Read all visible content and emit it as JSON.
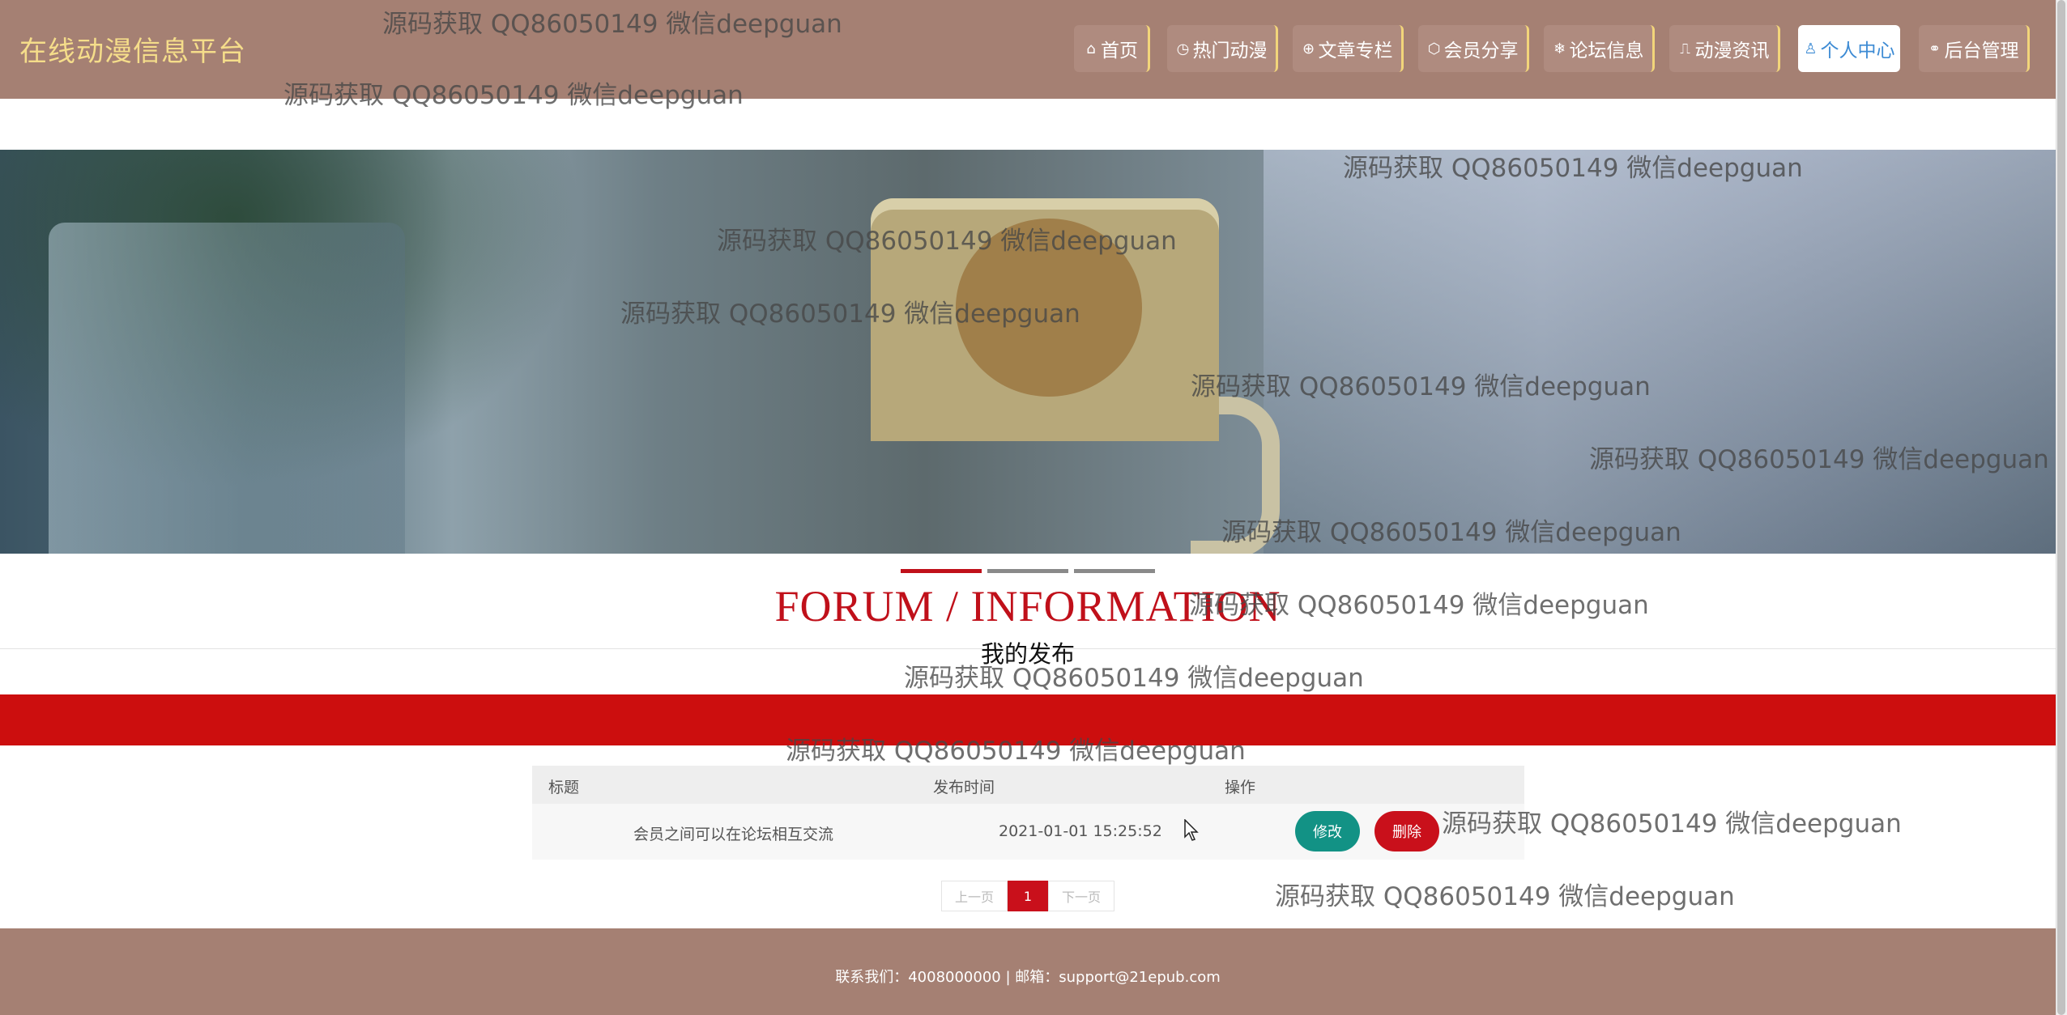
{
  "header": {
    "brand": "在线动漫信息平台",
    "nav": [
      {
        "label": "首页",
        "icon": "home-icon",
        "glyph": "⌂"
      },
      {
        "label": "热门动漫",
        "icon": "clock-icon",
        "glyph": "◷"
      },
      {
        "label": "文章专栏",
        "icon": "globe-icon",
        "glyph": "⊕"
      },
      {
        "label": "会员分享",
        "icon": "box-icon",
        "glyph": "⬡"
      },
      {
        "label": "论坛信息",
        "icon": "snowflake-icon",
        "glyph": "❄"
      },
      {
        "label": "动漫资讯",
        "icon": "book-icon",
        "glyph": "⎍"
      },
      {
        "label": "个人中心",
        "icon": "user-icon",
        "glyph": "♙"
      },
      {
        "label": "后台管理",
        "icon": "link-icon",
        "glyph": "⚭"
      }
    ],
    "active_nav": "个人中心"
  },
  "section": {
    "title_en": "FORUM / INFORMATION",
    "title_cn": "我的发布"
  },
  "table": {
    "headers": [
      "标题",
      "发布时间",
      "操作"
    ],
    "rows": [
      {
        "title": "会员之间可以在论坛相互交流",
        "time": "2021-01-01 15:25:52",
        "edit": "修改",
        "delete": "删除"
      }
    ]
  },
  "pager": {
    "prev": "上一页",
    "current": "1",
    "next": "下一页"
  },
  "footer": {
    "text": "联系我们：4008000000 | 邮箱：support@21epub.com"
  },
  "watermark": "源码获取 QQ86050149 微信deepguan",
  "colors": {
    "header_bg": "#a58073",
    "brand": "#f5dd8a",
    "accent_red": "#c9101b",
    "edit_green": "#129285",
    "active_nav_text": "#3d8bd4"
  }
}
